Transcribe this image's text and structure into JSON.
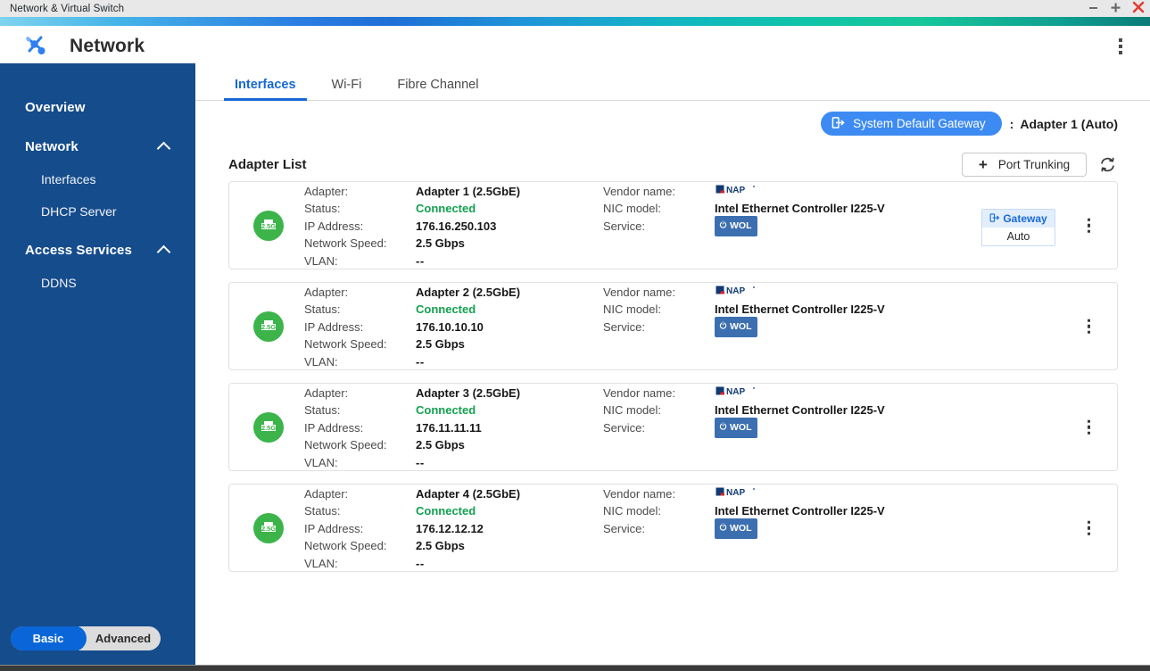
{
  "window": {
    "title": "Network & Virtual Switch",
    "controls": {
      "minimize": "—",
      "maximize": "+",
      "close": "✕"
    }
  },
  "header": {
    "app_title": "Network",
    "logo_icon": "network-app-icon",
    "menu_icon": "kebab-menu-icon"
  },
  "sidebar": {
    "overview": {
      "label": "Overview"
    },
    "groups": [
      {
        "label": "Network",
        "expanded": true,
        "items": [
          {
            "label": "Interfaces",
            "active": true
          },
          {
            "label": "DHCP Server",
            "active": false
          }
        ]
      },
      {
        "label": "Access Services",
        "expanded": true,
        "items": [
          {
            "label": "DDNS",
            "active": false
          }
        ]
      }
    ],
    "mode_toggle": {
      "basic": "Basic",
      "advanced": "Advanced",
      "selected": "Basic"
    }
  },
  "main": {
    "tabs": [
      {
        "label": "Interfaces",
        "active": true
      },
      {
        "label": "Wi-Fi",
        "active": false
      },
      {
        "label": "Fibre Channel",
        "active": false
      }
    ],
    "gateway_bar": {
      "button_label": "System Default Gateway",
      "button_icon": "gateway-icon",
      "separator": ":",
      "value": "Adapter 1 (Auto)"
    },
    "list_header": {
      "title": "Adapter List",
      "port_trunking_label": "Port Trunking",
      "port_trunking_plus": "+",
      "refresh_icon": "refresh-icon"
    },
    "field_labels": {
      "adapter": "Adapter:",
      "status": "Status:",
      "ip_address": "IP Address:",
      "network_speed": "Network Speed:",
      "vlan": "VLAN:",
      "vendor_name": "Vendor name:",
      "nic_model": "NIC model:",
      "service": "Service:"
    },
    "gateway_box": {
      "title": "Gateway",
      "mode": "Auto",
      "icon": "gateway-icon"
    },
    "adapters": [
      {
        "icon_label": "2.5G",
        "icon_color": "#3cb44a",
        "adapter": "Adapter 1 (2.5GbE)",
        "status": "Connected",
        "ip_address": "176.16.250.103",
        "network_speed": "2.5 Gbps",
        "vlan": "--",
        "vendor_name": "QNAP",
        "nic_model": "Intel Ethernet Controller I225-V",
        "service": "WOL",
        "has_gateway_box": true
      },
      {
        "icon_label": "2.5G",
        "icon_color": "#3cb44a",
        "adapter": "Adapter 2 (2.5GbE)",
        "status": "Connected",
        "ip_address": "176.10.10.10",
        "network_speed": "2.5 Gbps",
        "vlan": "--",
        "vendor_name": "QNAP",
        "nic_model": "Intel Ethernet Controller I225-V",
        "service": "WOL",
        "has_gateway_box": false
      },
      {
        "icon_label": "2.5G",
        "icon_color": "#3cb44a",
        "adapter": "Adapter 3 (2.5GbE)",
        "status": "Connected",
        "ip_address": "176.11.11.11",
        "network_speed": "2.5 Gbps",
        "vlan": "--",
        "vendor_name": "QNAP",
        "nic_model": "Intel Ethernet Controller I225-V",
        "service": "WOL",
        "has_gateway_box": false
      },
      {
        "icon_label": "2.5G",
        "icon_color": "#3cb44a",
        "adapter": "Adapter 4 (2.5GbE)",
        "status": "Connected",
        "ip_address": "176.12.12.12",
        "network_speed": "2.5 Gbps",
        "vlan": "--",
        "vendor_name": "QNAP",
        "nic_model": "Intel Ethernet Controller I225-V",
        "service": "WOL",
        "has_gateway_box": false
      }
    ]
  },
  "colors": {
    "sidebar_bg": "#154c8c",
    "accent_blue": "#1769d6",
    "pill_blue": "#3d8bf2",
    "status_green": "#13a050",
    "adapter_icon_green": "#3cb44a",
    "wol_badge": "#3c6fb0",
    "qnap_navy": "#123a72",
    "qnap_red": "#d7232e"
  }
}
